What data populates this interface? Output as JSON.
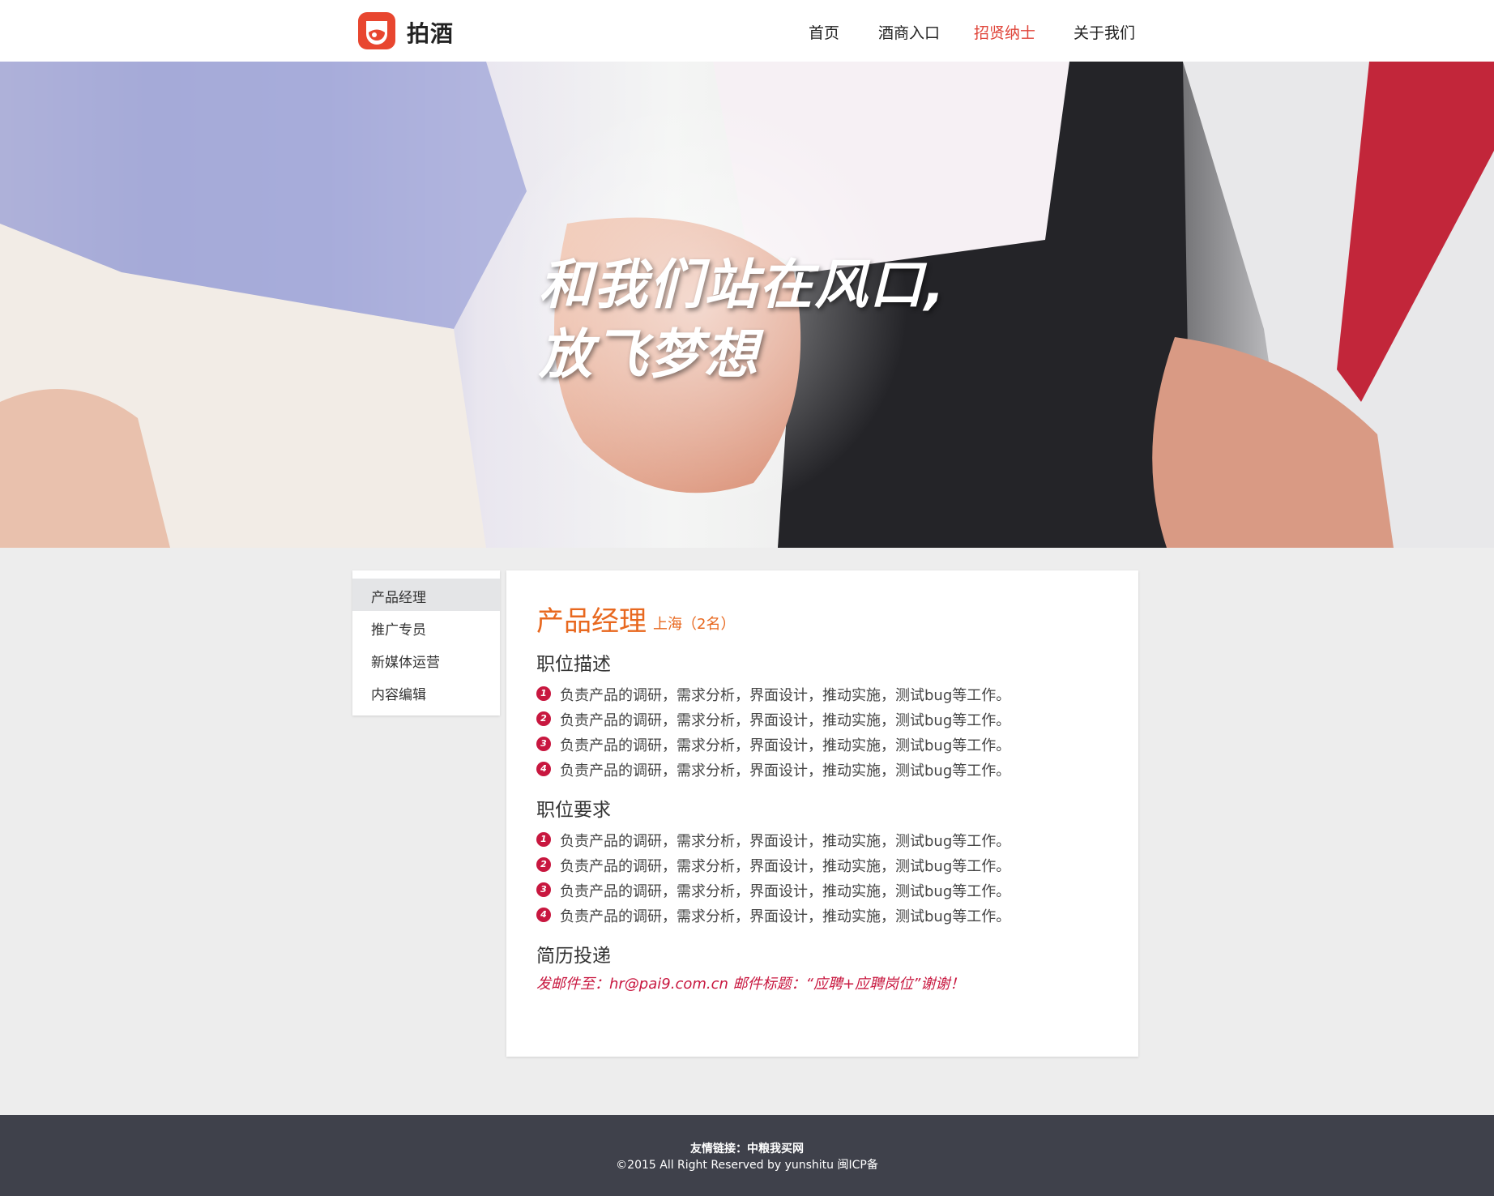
{
  "header": {
    "logo_icon": "cup-logo-icon",
    "logo_text": "拍酒",
    "nav": [
      {
        "label": "首页",
        "active": false
      },
      {
        "label": "酒商入口",
        "active": false
      },
      {
        "label": "招贤纳士",
        "active": true
      },
      {
        "label": "关于我们",
        "active": false
      }
    ]
  },
  "banner": {
    "line1": "和我们站在风口,",
    "line2": "放飞梦想"
  },
  "sidebar": {
    "items": [
      {
        "label": "产品经理",
        "active": true
      },
      {
        "label": "推广专员",
        "active": false
      },
      {
        "label": "新媒体运营",
        "active": false
      },
      {
        "label": "内容编辑",
        "active": false
      }
    ]
  },
  "job": {
    "title": "产品经理",
    "location": "上海（2名）",
    "description_heading": "职位描述",
    "description": [
      {
        "num": "1",
        "text": "负责产品的调研，需求分析，界面设计，推动实施，测试bug等工作。"
      },
      {
        "num": "2",
        "text": "负责产品的调研，需求分析，界面设计，推动实施，测试bug等工作。"
      },
      {
        "num": "3",
        "text": "负责产品的调研，需求分析，界面设计，推动实施，测试bug等工作。"
      },
      {
        "num": "4",
        "text": "负责产品的调研，需求分析，界面设计，推动实施，测试bug等工作。"
      }
    ],
    "requirement_heading": "职位要求",
    "requirements": [
      {
        "num": "1",
        "text": "负责产品的调研，需求分析，界面设计，推动实施，测试bug等工作。"
      },
      {
        "num": "2",
        "text": "负责产品的调研，需求分析，界面设计，推动实施，测试bug等工作。"
      },
      {
        "num": "3",
        "text": "负责产品的调研，需求分析，界面设计，推动实施，测试bug等工作。"
      },
      {
        "num": "4",
        "text": "负责产品的调研，需求分析，界面设计，推动实施，测试bug等工作。"
      }
    ],
    "resume_heading": "简历投递",
    "resume_text": "发邮件至：hr@pai9.com.cn 邮件标题：“应聘+应聘岗位”谢谢！"
  },
  "footer": {
    "links_label": "友情链接：",
    "link_text": "中粮我买网",
    "copyright": "©2015 All Right Reserved by yunshitu 闽ICP备"
  },
  "colors": {
    "accent": "#e0463b",
    "title_orange": "#e8681f",
    "number_red": "#c8173f",
    "footer_bg": "#3f414b",
    "page_bg": "#ededed"
  }
}
